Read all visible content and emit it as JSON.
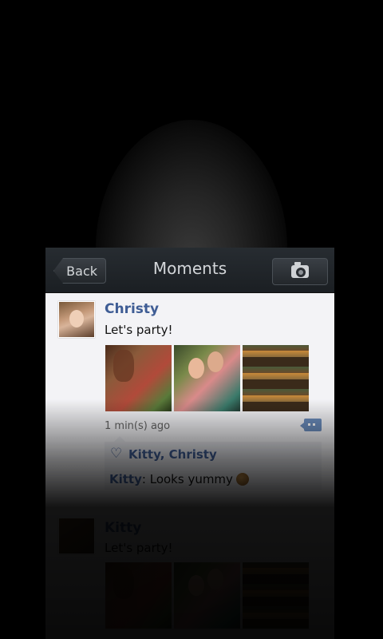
{
  "header": {
    "back_label": "Back",
    "title": "Moments",
    "camera_icon": "camera-icon"
  },
  "posts": [
    {
      "author": "Christy",
      "text": "Let's party!",
      "photos": [
        "photo-shopping",
        "photo-friends",
        "photo-cakes"
      ],
      "time": "1 min(s) ago",
      "likes": "Kitty,  Christy",
      "comments": [
        {
          "user": "Kitty",
          "text": " Looks yummy"
        }
      ]
    },
    {
      "author": "Kitty",
      "text": "Let's party!"
    }
  ],
  "colors": {
    "link_blue": "#3f5d95",
    "topbar": "#1b1f23",
    "card_bg": "#f3f3f6"
  }
}
